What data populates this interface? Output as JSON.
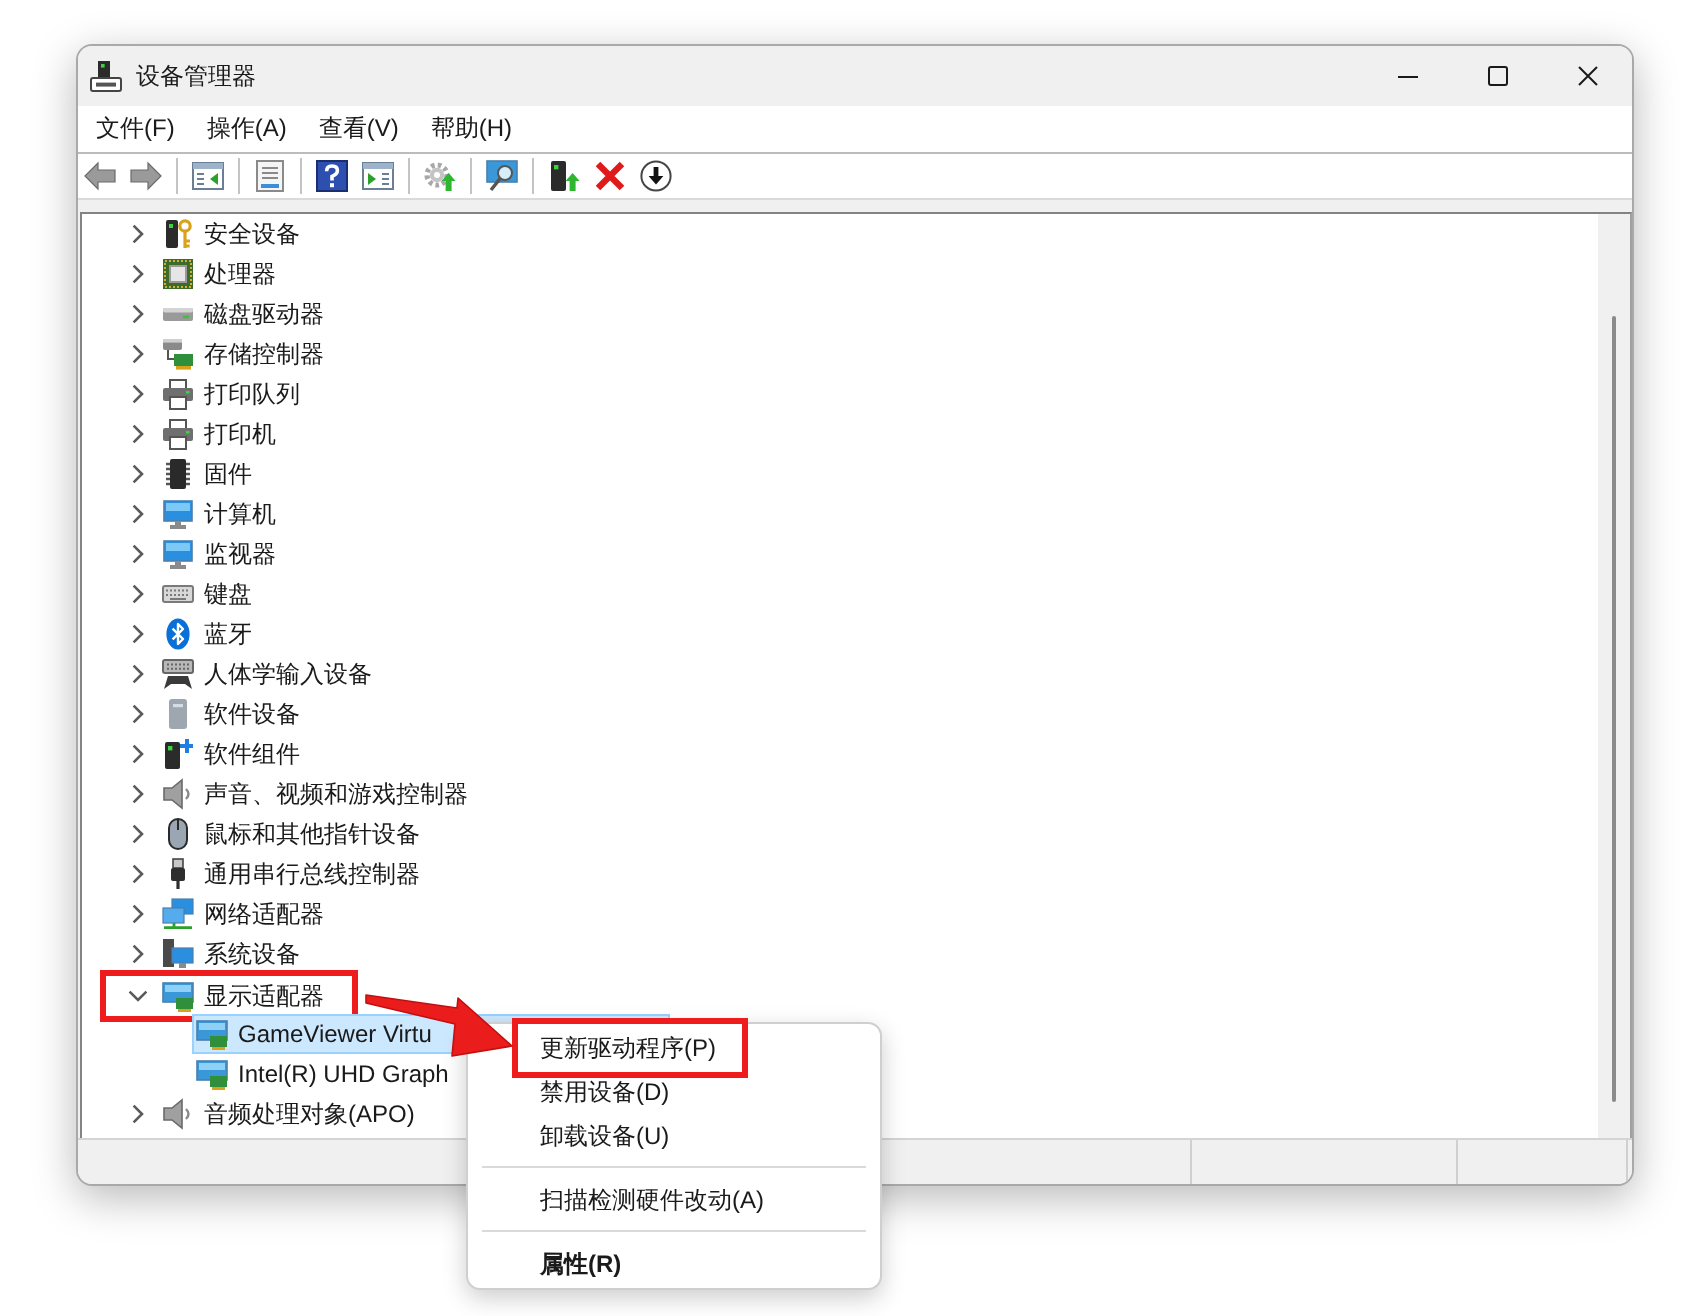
{
  "window": {
    "title": "设备管理器"
  },
  "menu_bar": [
    "文件(F)",
    "操作(A)",
    "查看(V)",
    "帮助(H)"
  ],
  "toolbar": [
    [
      {
        "kind": "back",
        "disabled": true
      },
      {
        "kind": "forward",
        "disabled": true
      }
    ],
    [
      {
        "kind": "console",
        "disabled": false
      }
    ],
    [
      {
        "kind": "properties",
        "disabled": false
      }
    ],
    [
      {
        "kind": "help",
        "disabled": false
      },
      {
        "kind": "action",
        "disabled": false
      }
    ],
    [
      {
        "kind": "update",
        "disabled": false
      }
    ],
    [
      {
        "kind": "scan",
        "disabled": false
      }
    ],
    [
      {
        "kind": "enable",
        "disabled": false
      },
      {
        "kind": "uninstall",
        "disabled": false
      },
      {
        "kind": "disable",
        "disabled": false
      }
    ]
  ],
  "tree": [
    {
      "label": "安全设备",
      "kind": "security",
      "expanded": false,
      "selected": false,
      "boxed": false
    },
    {
      "label": "处理器",
      "kind": "processor",
      "expanded": false,
      "selected": false,
      "boxed": false
    },
    {
      "label": "磁盘驱动器",
      "kind": "disk",
      "expanded": false,
      "selected": false,
      "boxed": false
    },
    {
      "label": "存储控制器",
      "kind": "storage",
      "expanded": false,
      "selected": false,
      "boxed": false
    },
    {
      "label": "打印队列",
      "kind": "printer",
      "expanded": false,
      "selected": false,
      "boxed": false
    },
    {
      "label": "打印机",
      "kind": "printer",
      "expanded": false,
      "selected": false,
      "boxed": false
    },
    {
      "label": "固件",
      "kind": "firmware",
      "expanded": false,
      "selected": false,
      "boxed": false
    },
    {
      "label": "计算机",
      "kind": "computer",
      "expanded": false,
      "selected": false,
      "boxed": false
    },
    {
      "label": "监视器",
      "kind": "monitor",
      "expanded": false,
      "selected": false,
      "boxed": false
    },
    {
      "label": "键盘",
      "kind": "keyboard",
      "expanded": false,
      "selected": false,
      "boxed": false
    },
    {
      "label": "蓝牙",
      "kind": "bluetooth",
      "expanded": false,
      "selected": false,
      "boxed": false
    },
    {
      "label": "人体学输入设备",
      "kind": "hid",
      "expanded": false,
      "selected": false,
      "boxed": false
    },
    {
      "label": "软件设备",
      "kind": "software",
      "expanded": false,
      "selected": false,
      "boxed": false
    },
    {
      "label": "软件组件",
      "kind": "component",
      "expanded": false,
      "selected": false,
      "boxed": false
    },
    {
      "label": "声音、视频和游戏控制器",
      "kind": "audio",
      "expanded": false,
      "selected": false,
      "boxed": false
    },
    {
      "label": "鼠标和其他指针设备",
      "kind": "mouse",
      "expanded": false,
      "selected": false,
      "boxed": false
    },
    {
      "label": "通用串行总线控制器",
      "kind": "usb",
      "expanded": false,
      "selected": false,
      "boxed": false
    },
    {
      "label": "网络适配器",
      "kind": "network",
      "expanded": false,
      "selected": false,
      "boxed": false
    },
    {
      "label": "系统设备",
      "kind": "system",
      "expanded": false,
      "selected": false,
      "boxed": false
    },
    {
      "label": "显示适配器",
      "kind": "display",
      "expanded": true,
      "selected": false,
      "boxed": true,
      "children": [
        {
          "label": "GameViewer Virtu",
          "kind": "display",
          "selected": true,
          "boxed": false
        },
        {
          "label": "Intel(R) UHD Graph",
          "kind": "display",
          "selected": false,
          "boxed": false
        }
      ]
    },
    {
      "label": "音频处理对象(APO)",
      "kind": "audio",
      "expanded": false,
      "selected": false,
      "boxed": false
    }
  ],
  "context_menu": [
    [
      {
        "label": "更新驱动程序(P)",
        "default": false,
        "boxed": true
      },
      {
        "label": "禁用设备(D)",
        "default": false,
        "boxed": false
      },
      {
        "label": "卸载设备(U)",
        "default": false,
        "boxed": false
      }
    ],
    [
      {
        "label": "扫描检测硬件改动(A)",
        "default": false,
        "boxed": false
      }
    ],
    [
      {
        "label": "属性(R)",
        "default": true,
        "boxed": false
      }
    ]
  ],
  "callout_arrow": true
}
